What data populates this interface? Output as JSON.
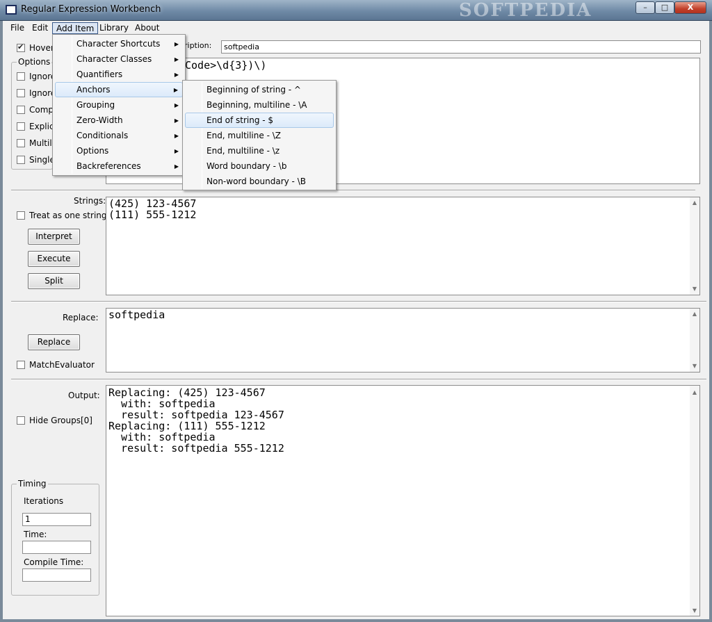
{
  "window": {
    "title": "Regular Expression Workbench",
    "watermark": "SOFTPEDIA",
    "controls": {
      "minimize": "–",
      "maximize": "□",
      "close": "X"
    }
  },
  "menubar": [
    "File",
    "Edit",
    "Add Item",
    "Library",
    "About"
  ],
  "top": {
    "hover_label": "Hover",
    "hover_checked": true,
    "description_label": "ription:",
    "description_value": "softpedia",
    "regex_text": "Code>\\d{3})\\)",
    "options_title": "Options",
    "options": [
      "Ignore",
      "Ignore",
      "Compi",
      "Explic",
      "Multili",
      "Single"
    ]
  },
  "add_item_menu": [
    "Character Shortcuts",
    "Character Classes",
    "Quantifiers",
    "Anchors",
    "Grouping",
    "Zero-Width",
    "Conditionals",
    "Options",
    "Backreferences"
  ],
  "anchors_menu": [
    "Beginning of string - ^",
    "Beginning, multiline - \\A",
    "End of string - $",
    "End, multiline - \\Z",
    "End, multiline -  \\z",
    "Word boundary - \\b",
    "Non-word boundary - \\B"
  ],
  "strings": {
    "label": "Strings:",
    "treat_as_one": "Treat as one string",
    "buttons": {
      "interpret": "Interpret",
      "execute": "Execute",
      "split": "Split"
    },
    "lines": [
      "(425) 123-4567",
      "(111) 555-1212"
    ]
  },
  "replace": {
    "label": "Replace:",
    "button": "Replace",
    "match_evaluator": "MatchEvaluator",
    "value": "softpedia"
  },
  "output": {
    "label": "Output:",
    "hide_groups": "Hide Groups[0]",
    "lines": [
      "Replacing: (425) 123-4567",
      "  with: softpedia",
      "  result: softpedia 123-4567",
      "Replacing: (111) 555-1212",
      "  with: softpedia",
      "  result: softpedia 555-1212"
    ]
  },
  "timing": {
    "title": "Timing",
    "iterations_label": "Iterations",
    "iterations_value": "1",
    "time_label": "Time:",
    "time_value": "",
    "compile_time_label": "Compile Time:",
    "compile_time_value": ""
  },
  "colors": {
    "menu_highlight": "#dceafa",
    "titlebar": "#6f8aa6",
    "close_button": "#c2402a"
  }
}
